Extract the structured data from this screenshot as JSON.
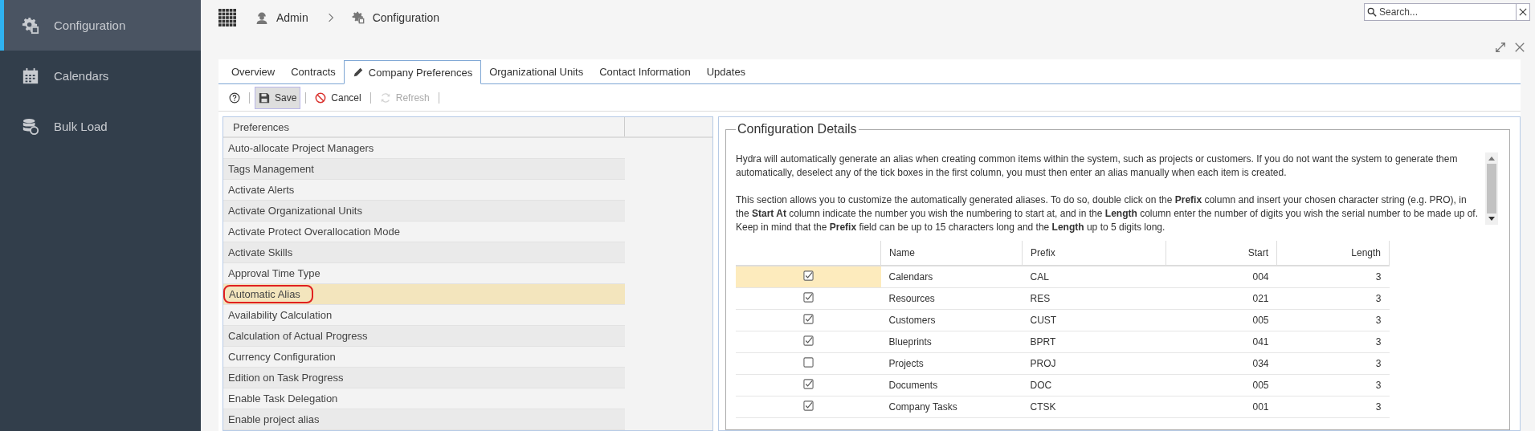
{
  "sidebar": {
    "items": [
      {
        "label": "Configuration",
        "selected": true
      },
      {
        "label": "Calendars",
        "selected": false
      },
      {
        "label": "Bulk Load",
        "selected": false
      }
    ]
  },
  "breadcrumb": [
    {
      "label": "Admin"
    },
    {
      "label": "Configuration"
    }
  ],
  "search": {
    "placeholder": "Search..."
  },
  "tabs": [
    {
      "label": "Overview",
      "selected": false
    },
    {
      "label": "Contracts",
      "selected": false
    },
    {
      "label": "Company Preferences",
      "selected": true
    },
    {
      "label": "Organizational Units",
      "selected": false
    },
    {
      "label": "Contact Information",
      "selected": false
    },
    {
      "label": "Updates",
      "selected": false
    }
  ],
  "toolbar": [
    {
      "kind": "help",
      "disabled": false,
      "pressed": false
    },
    {
      "kind": "save",
      "label": "Save",
      "disabled": false,
      "pressed": true
    },
    {
      "kind": "cancel",
      "label": "Cancel",
      "disabled": false,
      "pressed": false
    },
    {
      "kind": "refresh",
      "label": "Refresh",
      "disabled": true,
      "pressed": false
    }
  ],
  "preferences": {
    "header": "Preferences",
    "items": [
      {
        "label": "Auto-allocate Project Managers",
        "selected": false,
        "circled": false
      },
      {
        "label": "Tags Management",
        "selected": false,
        "circled": false
      },
      {
        "label": "Activate Alerts",
        "selected": false,
        "circled": false
      },
      {
        "label": "Activate Organizational Units",
        "selected": false,
        "circled": false
      },
      {
        "label": "Activate Protect Overallocation Mode",
        "selected": false,
        "circled": false
      },
      {
        "label": "Activate Skills",
        "selected": false,
        "circled": false
      },
      {
        "label": "Approval Time Type",
        "selected": false,
        "circled": false
      },
      {
        "label": "Automatic Alias",
        "selected": true,
        "circled": true
      },
      {
        "label": "Availability Calculation",
        "selected": false,
        "circled": false
      },
      {
        "label": "Calculation of Actual Progress",
        "selected": false,
        "circled": false
      },
      {
        "label": "Currency Configuration",
        "selected": false,
        "circled": false
      },
      {
        "label": "Edition on Task Progress",
        "selected": false,
        "circled": false
      },
      {
        "label": "Enable Task Delegation",
        "selected": false,
        "circled": false
      },
      {
        "label": "Enable project alias",
        "selected": false,
        "circled": false
      }
    ]
  },
  "details": {
    "title": "Configuration Details",
    "paragraphs": [
      "Hydra will automatically generate an alias when creating common items within the system, such as projects or customers. If you do not want the system to generate them automatically, deselect any of the tick boxes in the first column, you must then enter an alias manually when each item is created.",
      "This section allows you to customize the automatically generated aliases.  To do so, double click on the **Prefix** column and insert your chosen character string (e.g. PRO), in the **Start At** column indicate the number you wish the numbering to start at, and in the **Length** column enter the number of digits you wish the serial number to be made up of.  Keep in mind that the **Prefix** field can be up to 15 characters long and the **Length** up to 5 digits long."
    ],
    "table": {
      "columns": [
        "Name",
        "Prefix",
        "Start",
        "Length"
      ],
      "rows": [
        {
          "enabled": true,
          "name": "Calendars",
          "prefix": "CAL",
          "start": "004",
          "length": "3",
          "selected": true
        },
        {
          "enabled": true,
          "name": "Resources",
          "prefix": "RES",
          "start": "021",
          "length": "3",
          "selected": false
        },
        {
          "enabled": true,
          "name": "Customers",
          "prefix": "CUST",
          "start": "005",
          "length": "3",
          "selected": false
        },
        {
          "enabled": true,
          "name": "Blueprints",
          "prefix": "BPRT",
          "start": "041",
          "length": "3",
          "selected": false
        },
        {
          "enabled": false,
          "name": "Projects",
          "prefix": "PROJ",
          "start": "034",
          "length": "3",
          "selected": false
        },
        {
          "enabled": true,
          "name": "Documents",
          "prefix": "DOC",
          "start": "005",
          "length": "3",
          "selected": false
        },
        {
          "enabled": true,
          "name": "Company Tasks",
          "prefix": "CTSK",
          "start": "001",
          "length": "3",
          "selected": false
        }
      ]
    }
  }
}
